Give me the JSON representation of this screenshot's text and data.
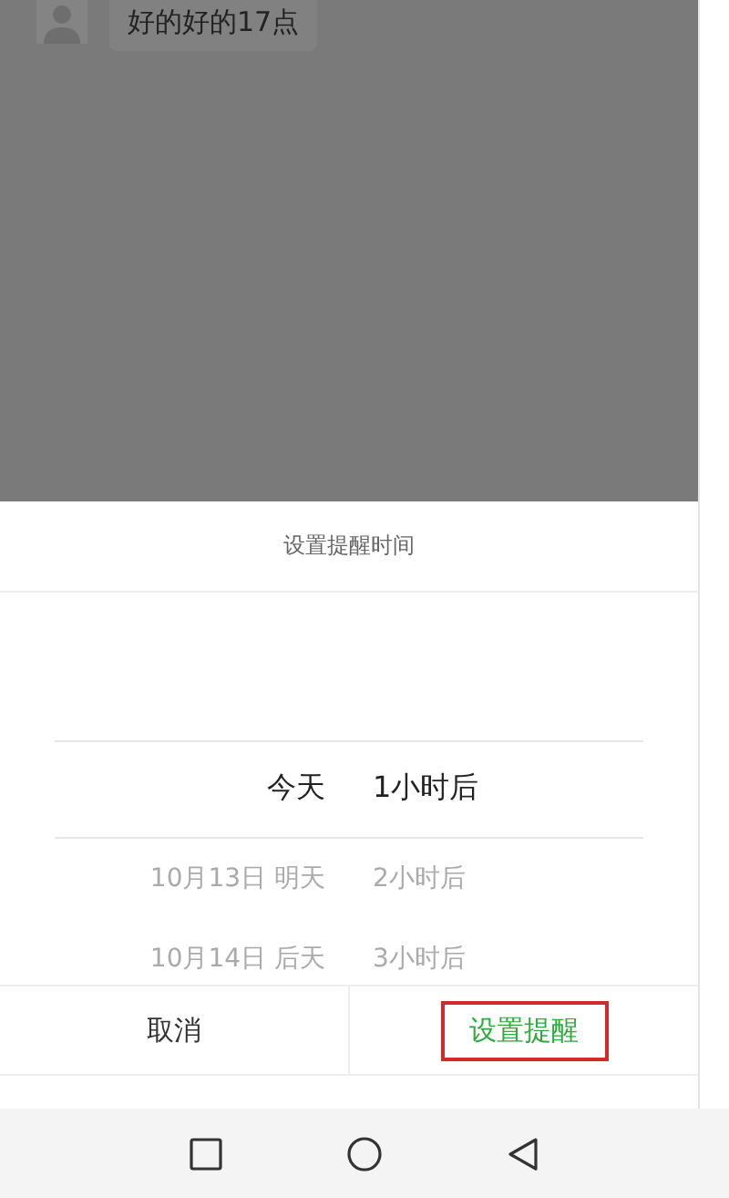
{
  "chat": {
    "message": "好的好的17点"
  },
  "sheet": {
    "title": "设置提醒时间",
    "picker": [
      {
        "date": "今天",
        "offset": "1小时后",
        "selected": true
      },
      {
        "date": "10月13日 明天",
        "offset": "2小时后",
        "selected": false
      },
      {
        "date": "10月14日 后天",
        "offset": "3小时后",
        "selected": false
      }
    ],
    "buttons": [
      {
        "label": "取消",
        "kind": "cancel",
        "highlighted": false
      },
      {
        "label": "设置提醒",
        "kind": "confirm",
        "highlighted": true
      }
    ]
  }
}
